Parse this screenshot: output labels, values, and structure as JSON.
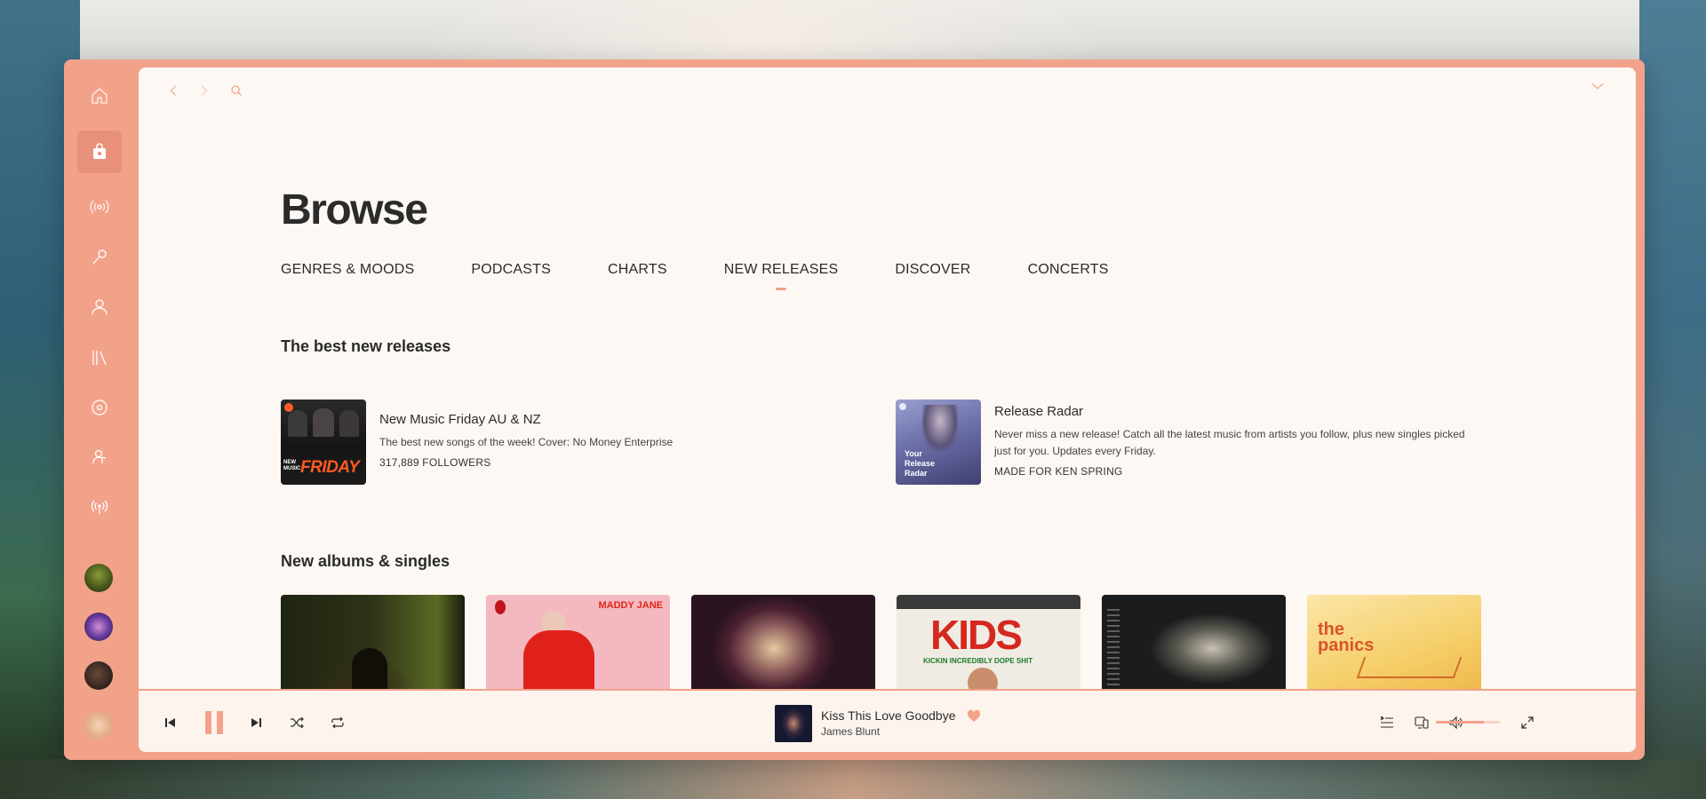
{
  "sidebar": {
    "items": [
      {
        "name": "home",
        "icon": "home-icon"
      },
      {
        "name": "browse",
        "icon": "shopping-bag-icon",
        "active": true
      },
      {
        "name": "radio",
        "icon": "radio-waves-icon"
      },
      {
        "name": "lyrics",
        "icon": "microphone-icon"
      },
      {
        "name": "profile",
        "icon": "user-icon"
      },
      {
        "name": "library",
        "icon": "library-icon"
      },
      {
        "name": "discover",
        "icon": "disc-icon"
      },
      {
        "name": "artists",
        "icon": "artist-icon"
      },
      {
        "name": "podcasts",
        "icon": "broadcast-icon"
      }
    ],
    "playlists": [
      "playlist-1",
      "playlist-2",
      "playlist-3",
      "playlist-4"
    ]
  },
  "page": {
    "title": "Browse",
    "tabs": [
      {
        "label": "GENRES & MOODS"
      },
      {
        "label": "PODCASTS"
      },
      {
        "label": "CHARTS"
      },
      {
        "label": "NEW RELEASES",
        "active": true
      },
      {
        "label": "DISCOVER"
      },
      {
        "label": "CONCERTS"
      }
    ],
    "best_new_title": "The best new releases",
    "featured": [
      {
        "title": "New Music Friday AU & NZ",
        "desc": "The best new songs of the week! Cover: No Money Enterprise",
        "meta": "317,889 FOLLOWERS",
        "cover_text": "FRIDAY",
        "cover_small": "NEW MUSIC"
      },
      {
        "title": "Release Radar",
        "desc": "Never miss a new release! Catch all the latest music from artists you follow, plus new singles picked just for you. Updates every Friday.",
        "meta": "MADE FOR KEN SPRING",
        "cover_text": "Your Release Radar"
      }
    ],
    "albums_title": "New albums & singles",
    "albums": [
      {
        "text": ""
      },
      {
        "text": "MADDY JANE"
      },
      {
        "text": ""
      },
      {
        "text": "KIDS",
        "sub": "KICKIN INCREDIBLY DOPE SHIT"
      },
      {
        "text": ""
      },
      {
        "text": "the panics"
      }
    ]
  },
  "player": {
    "title": "Kiss This Love Goodbye",
    "artist": "James Blunt",
    "liked": true,
    "volume": 0.75,
    "accent": "#f3a28a"
  }
}
